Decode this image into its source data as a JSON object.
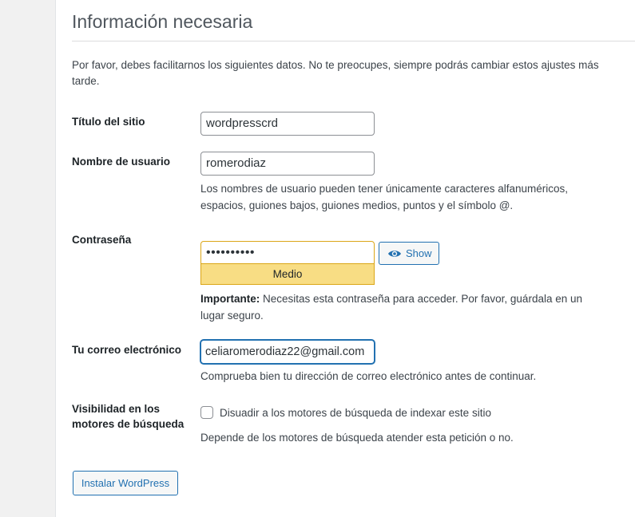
{
  "heading": "Información necesaria",
  "intro": "Por favor, debes facilitarnos los siguientes datos. No te preocupes, siempre podrás cambiar estos ajustes más tarde.",
  "fields": {
    "site_title": {
      "label": "Título del sitio",
      "value": "wordpresscrd"
    },
    "username": {
      "label": "Nombre de usuario",
      "value": "romerodiaz",
      "help": "Los nombres de usuario pueden tener únicamente caracteres alfanuméricos, espacios, guiones bajos, guiones medios, puntos y el símbolo @."
    },
    "password": {
      "label": "Contraseña",
      "value": "••••••••••",
      "show_label": "Show",
      "strength": "Medio",
      "important_label": "Importante:",
      "important_text": " Necesitas esta contraseña para acceder. Por favor, guárdala en un lugar seguro."
    },
    "email": {
      "label": "Tu correo electrónico",
      "value": "celiaromerodiaz22@gmail.com",
      "help": "Comprueba bien tu dirección de correo electrónico antes de continuar."
    },
    "visibility": {
      "label_line1": "Visibilidad en los",
      "label_line2": "motores de búsqueda",
      "checkbox_label": "Disuadir a los motores de búsqueda de indexar este sitio",
      "checked": false,
      "help": "Depende de los motores de búsqueda atender esta petición o no."
    }
  },
  "submit_label": "Instalar WordPress",
  "colors": {
    "accent": "#2271b1",
    "strength_bg": "#f8dd84",
    "strength_border": "#dba617"
  },
  "icons": {
    "show": "eye-icon"
  }
}
